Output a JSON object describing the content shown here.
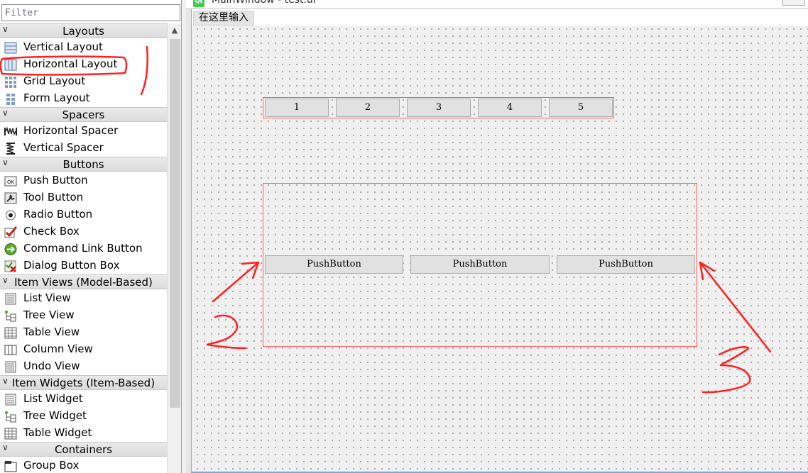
{
  "widget_box": {
    "filter_placeholder": "Filter",
    "scroll_up_glyph": "▲",
    "categories": {
      "layouts": "Layouts",
      "spacers": "Spacers",
      "buttons": "Buttons",
      "item_views": "Item Views (Model-Based)",
      "item_widgets": "Item Widgets (Item-Based)",
      "containers": "Containers"
    },
    "items": {
      "vertical_layout": "Vertical Layout",
      "horizontal_layout": "Horizontal Layout",
      "grid_layout": "Grid Layout",
      "form_layout": "Form Layout",
      "horizontal_spacer": "Horizontal Spacer",
      "vertical_spacer": "Vertical Spacer",
      "push_button": "Push Button",
      "tool_button": "Tool Button",
      "radio_button": "Radio Button",
      "check_box": "Check Box",
      "command_link_button": "Command Link Button",
      "dialog_button_box": "Dialog Button Box",
      "list_view": "List View",
      "tree_view": "Tree View",
      "table_view": "Table View",
      "column_view": "Column View",
      "undo_view": "Undo View",
      "list_widget": "List Widget",
      "tree_widget": "Tree Widget",
      "table_widget": "Table Widget",
      "group_box": "Group Box"
    },
    "ok_icon_text": "OK"
  },
  "design": {
    "window_title": "MainWindow - test.ui*",
    "qt_badge": "Qt",
    "menu_item": "在这里输入",
    "row1_buttons": [
      "1",
      "2",
      "3",
      "4",
      "5"
    ],
    "row2_buttons": [
      "PushButton",
      "PushButton",
      "PushButton"
    ]
  },
  "colors": {
    "annotation_red": "#ff2020",
    "layout_frame": "#ff5c5c"
  }
}
